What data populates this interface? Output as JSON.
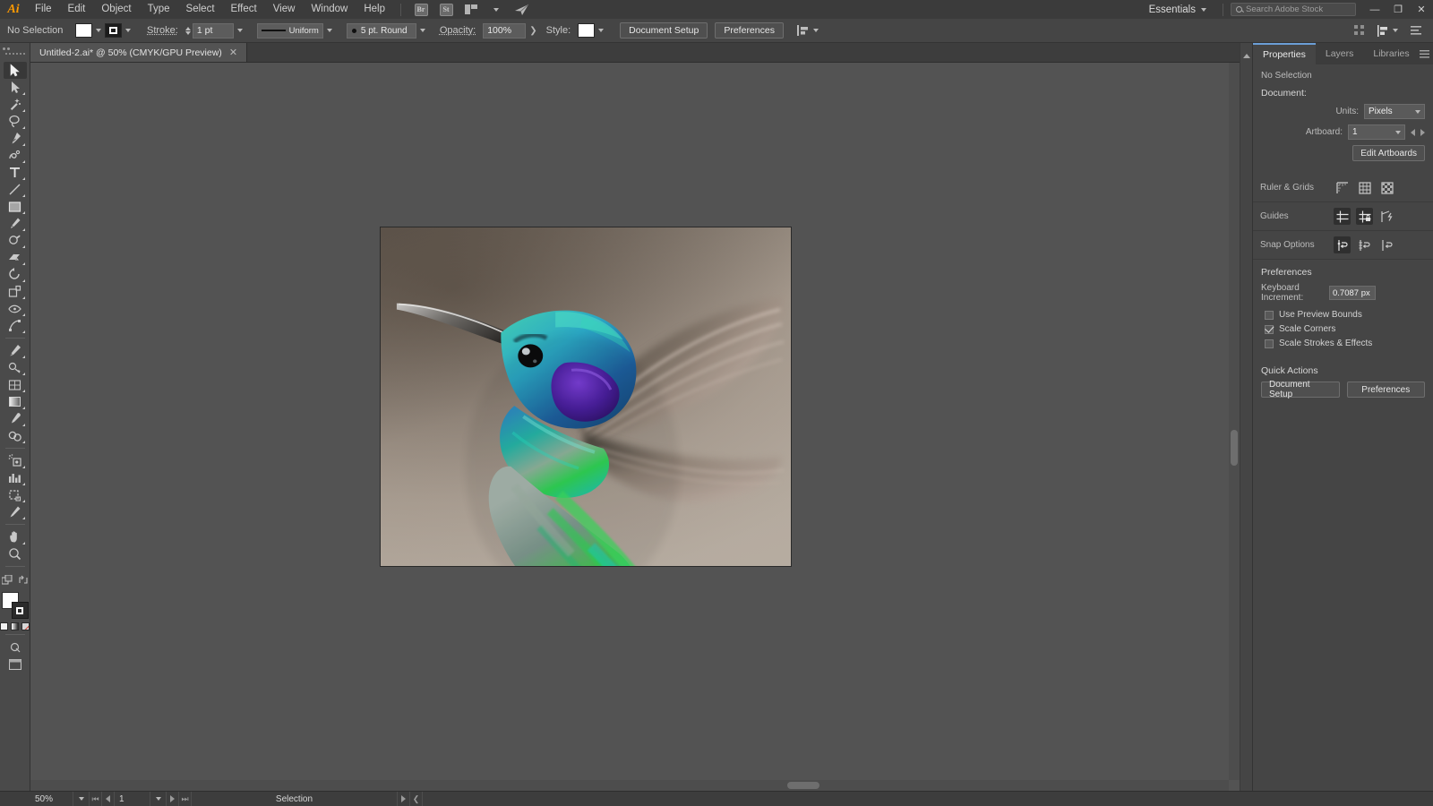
{
  "app": {
    "name": "Adobe Illustrator",
    "logo_text": "Ai"
  },
  "menubar": {
    "items": [
      "File",
      "Edit",
      "Object",
      "Type",
      "Select",
      "Effect",
      "View",
      "Window",
      "Help"
    ],
    "bridge_label": "Br",
    "stock_label": "St",
    "arrange_name": "arrange-documents",
    "share_name": "share-icon",
    "workspace": "Essentials",
    "search_placeholder": "Search Adobe Stock",
    "window_minimize": "—",
    "window_restore": "❐",
    "window_close": "✕"
  },
  "controlbar": {
    "selection_state": "No Selection",
    "fill_swatch_color": "#ffffff",
    "stroke_label": "Stroke:",
    "stroke_weight": "1 pt",
    "stroke_profile": "Uniform",
    "brush_definition": "5 pt. Round",
    "opacity_label": "Opacity:",
    "opacity_value": "100%",
    "style_label": "Style:",
    "document_setup": "Document Setup",
    "preferences": "Preferences"
  },
  "toolbar": {
    "tools": [
      {
        "name": "selection-tool",
        "selected": true
      },
      {
        "name": "direct-selection-tool",
        "selected": false
      },
      {
        "name": "magic-wand-tool",
        "selected": false
      },
      {
        "name": "lasso-tool",
        "selected": false
      },
      {
        "name": "pen-tool",
        "selected": false
      },
      {
        "name": "curvature-tool",
        "selected": false
      },
      {
        "name": "type-tool",
        "selected": false
      },
      {
        "name": "line-segment-tool",
        "selected": false
      },
      {
        "name": "rectangle-tool",
        "selected": false
      },
      {
        "name": "paintbrush-tool",
        "selected": false
      },
      {
        "name": "shaper-tool",
        "selected": false
      },
      {
        "name": "eraser-tool",
        "selected": false
      },
      {
        "name": "rotate-tool",
        "selected": false
      },
      {
        "name": "scale-tool",
        "selected": false
      },
      {
        "name": "width-tool",
        "selected": false
      },
      {
        "name": "free-transform-tool",
        "selected": false
      },
      {
        "name": "shape-builder-tool",
        "selected": false
      },
      {
        "name": "perspective-grid-tool",
        "selected": false
      },
      {
        "name": "mesh-tool",
        "selected": false
      },
      {
        "name": "gradient-tool",
        "selected": false
      },
      {
        "name": "eyedropper-tool",
        "selected": false
      },
      {
        "name": "blend-tool",
        "selected": false
      },
      {
        "name": "symbol-sprayer-tool",
        "selected": false
      },
      {
        "name": "column-graph-tool",
        "selected": false
      },
      {
        "name": "artboard-tool",
        "selected": false
      },
      {
        "name": "slice-tool",
        "selected": false
      },
      {
        "name": "hand-tool",
        "selected": false
      },
      {
        "name": "zoom-tool",
        "selected": false
      }
    ],
    "fill_color": "#ffffff",
    "stroke_color": "#2b2b2b"
  },
  "document": {
    "tab_title": "Untitled-2.ai* @ 50% (CMYK/GPU Preview)",
    "close_symbol": "✕"
  },
  "artwork": {
    "name": "hummingbird-photo",
    "description": "Green violet-ear hummingbird in flight"
  },
  "panel": {
    "tabs": [
      {
        "label": "Properties",
        "active": true
      },
      {
        "label": "Layers",
        "active": false
      },
      {
        "label": "Libraries",
        "active": false
      }
    ],
    "selection_status": "No Selection",
    "document_section": {
      "title": "Document:",
      "units_label": "Units:",
      "units_value": "Pixels",
      "artboard_label": "Artboard:",
      "artboard_value": "1",
      "edit_artboards": "Edit Artboards"
    },
    "ruler_grids": {
      "label": "Ruler & Grids",
      "icons": [
        "show-rulers-icon",
        "show-grid-icon",
        "show-transparency-grid-icon"
      ]
    },
    "guides": {
      "label": "Guides",
      "icons": [
        "show-guides-icon",
        "lock-guides-icon",
        "smart-guides-icon"
      ]
    },
    "snap_options": {
      "label": "Snap Options",
      "icons": [
        "snap-to-point-icon",
        "snap-to-grid-icon",
        "snap-to-pixel-icon"
      ]
    },
    "preferences": {
      "title": "Preferences",
      "keyboard_increment_label": "Keyboard Increment:",
      "keyboard_increment_value": "0.7087 px",
      "checkboxes": [
        {
          "label": "Use Preview Bounds",
          "checked": false
        },
        {
          "label": "Scale Corners",
          "checked": true
        },
        {
          "label": "Scale Strokes & Effects",
          "checked": false
        }
      ]
    },
    "quick_actions": {
      "title": "Quick Actions",
      "buttons": [
        "Document Setup",
        "Preferences"
      ]
    }
  },
  "statusbar": {
    "zoom_level": "50%",
    "page_number": "1",
    "status_text": "Selection"
  },
  "colors": {
    "accent": "#6b9ed6",
    "panel_bg": "#454545",
    "canvas_bg": "#535353",
    "menubar_bg": "#3b3b3b",
    "brand": "#ff9a00"
  }
}
